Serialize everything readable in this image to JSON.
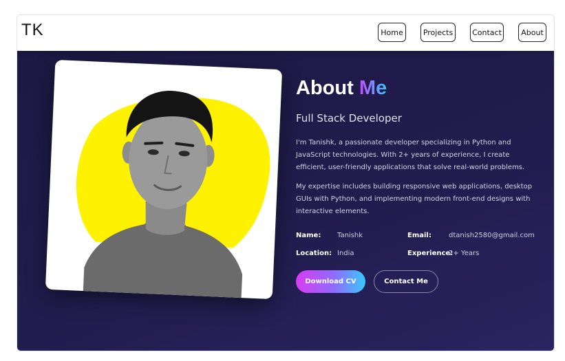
{
  "header": {
    "logo": "TK",
    "nav": [
      {
        "label": "Home"
      },
      {
        "label": "Projects"
      },
      {
        "label": "Contact"
      },
      {
        "label": "About"
      }
    ]
  },
  "about": {
    "title_main": "About",
    "title_accent": "Me",
    "subtitle": "Full Stack Developer",
    "paragraph1": "I'm Tanishk, a passionate developer specializing in Python and JavaScript technologies. With 2+ years of experience, I create efficient, user-friendly applications that solve real-world problems.",
    "paragraph2": "My expertise includes building responsive web applications, desktop GUIs with Python, and implementing modern front-end designs with interactive elements.",
    "info": {
      "name_label": "Name:",
      "name_value": "Tanishk",
      "email_label": "Email:",
      "email_value": "dtanish2580@gmail.com",
      "location_label": "Location:",
      "location_value": "India",
      "experience_label": "Experience:",
      "experience_value": "2+ Years"
    },
    "download_cv": "Download CV",
    "contact_me": "Contact Me"
  },
  "colors": {
    "hero_background": "#1f1a47",
    "blob": "#fff200",
    "accent_start": "#c54bff",
    "accent_end": "#34c7ff"
  },
  "icons": [
    "profile-photo"
  ]
}
